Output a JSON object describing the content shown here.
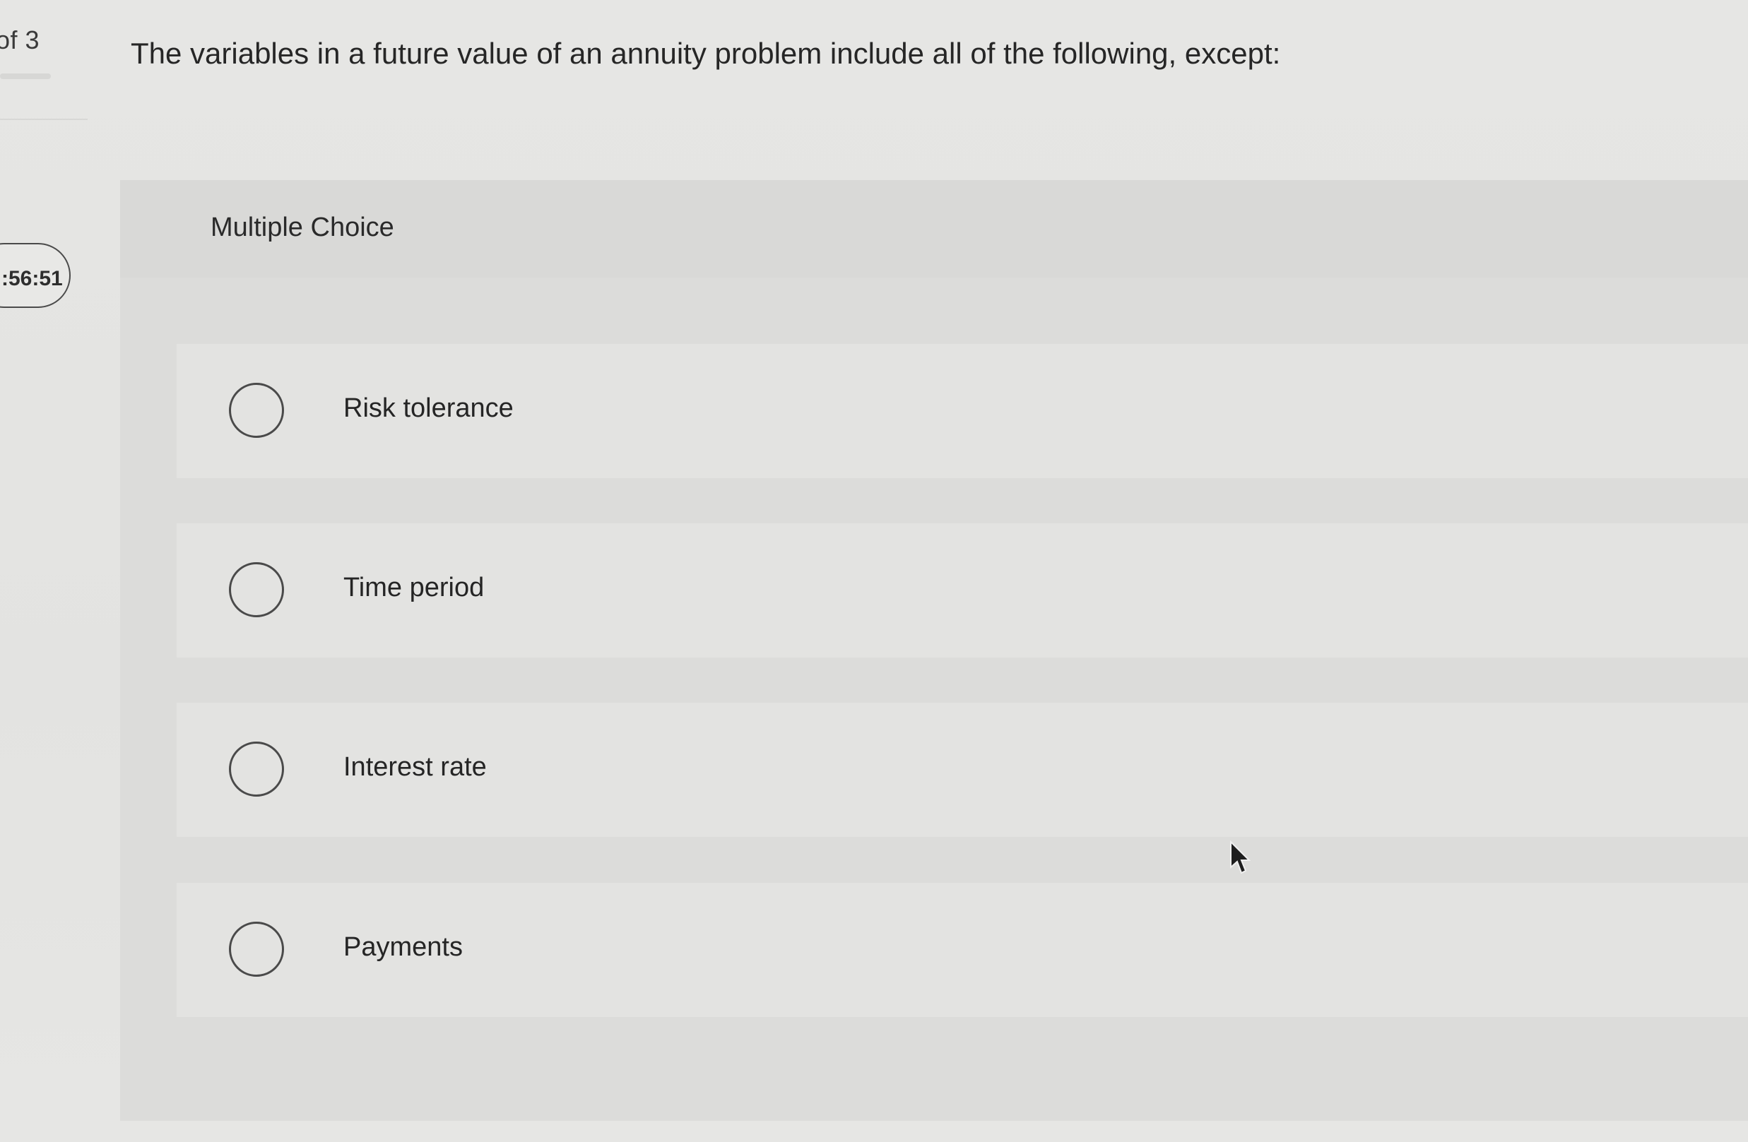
{
  "nav": {
    "progress": "of 3",
    "timer": ":56:51"
  },
  "question": {
    "text": "The variables in a future value of an annuity problem include all of the following, except:"
  },
  "answer_area": {
    "type_label": "Multiple Choice",
    "options": [
      {
        "label": "Risk tolerance",
        "selected": false
      },
      {
        "label": "Time period",
        "selected": false
      },
      {
        "label": "Interest rate",
        "selected": false
      },
      {
        "label": "Payments",
        "selected": false
      }
    ]
  },
  "colors": {
    "background": "#e4e4e2",
    "panel": "#dcdcda",
    "option_bg": "#e3e3e1",
    "text": "#262626",
    "radio_border": "#4a4a4a"
  },
  "icons": {
    "radio": "radio-unchecked-icon",
    "cursor": "mouse-pointer-icon"
  }
}
